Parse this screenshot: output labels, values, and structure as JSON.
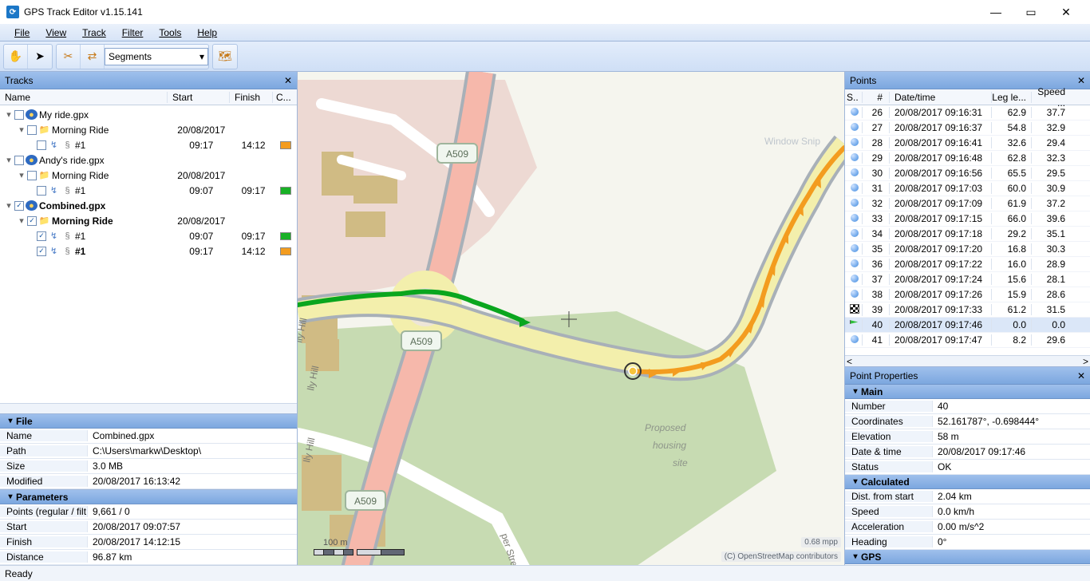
{
  "app": {
    "title": "GPS Track Editor v1.15.141"
  },
  "menu": {
    "items": [
      "File",
      "View",
      "Track",
      "Filter",
      "Tools",
      "Help"
    ]
  },
  "toolbar": {
    "segments_label": "Segments"
  },
  "panels": {
    "tracks_title": "Tracks",
    "points_title": "Points",
    "pointprops_title": "Point Properties"
  },
  "tracks_cols": {
    "name": "Name",
    "start": "Start",
    "finish": "Finish",
    "color": "C..."
  },
  "points_cols": {
    "s": "S..",
    "num": "#",
    "datetime": "Date/time",
    "leg": "Leg le...",
    "speed": "Speed ..."
  },
  "tracks": [
    {
      "kind": "gpx",
      "checked": false,
      "label": "My ride.gpx",
      "bold": false,
      "start": "",
      "finish": "",
      "color": ""
    },
    {
      "kind": "ride",
      "checked": false,
      "label": "Morning Ride",
      "bold": false,
      "start": "20/08/2017",
      "finish": "",
      "color": ""
    },
    {
      "kind": "seg",
      "checked": false,
      "label": "#1",
      "bold": false,
      "start": "09:17",
      "finish": "14:12",
      "color": "#f39c1f"
    },
    {
      "kind": "gpx",
      "checked": false,
      "label": "Andy's ride.gpx",
      "bold": false,
      "start": "",
      "finish": "",
      "color": ""
    },
    {
      "kind": "ride",
      "checked": false,
      "label": "Morning Ride",
      "bold": false,
      "start": "20/08/2017",
      "finish": "",
      "color": ""
    },
    {
      "kind": "seg",
      "checked": false,
      "label": "#1",
      "bold": false,
      "start": "09:07",
      "finish": "09:17",
      "color": "#19b126"
    },
    {
      "kind": "gpx",
      "checked": true,
      "label": "Combined.gpx",
      "bold": true,
      "start": "",
      "finish": "",
      "color": ""
    },
    {
      "kind": "ride",
      "checked": true,
      "label": "Morning Ride",
      "bold": true,
      "start": "20/08/2017",
      "finish": "",
      "color": ""
    },
    {
      "kind": "seg",
      "checked": true,
      "label": "#1",
      "bold": false,
      "start": "09:07",
      "finish": "09:17",
      "color": "#19b126"
    },
    {
      "kind": "seg",
      "checked": true,
      "label": "#1",
      "bold": true,
      "start": "09:17",
      "finish": "14:12",
      "color": "#f39c1f"
    }
  ],
  "file": {
    "header": "File",
    "rows": [
      {
        "label": "Name",
        "value": "Combined.gpx"
      },
      {
        "label": "Path",
        "value": "C:\\Users\\markw\\Desktop\\"
      },
      {
        "label": "Size",
        "value": "3.0 MB"
      },
      {
        "label": "Modified",
        "value": "20/08/2017 16:13:42"
      }
    ]
  },
  "parameters": {
    "header": "Parameters",
    "rows": [
      {
        "label": "Points (regular / filt",
        "value": "9,661 / 0"
      },
      {
        "label": "Start",
        "value": "20/08/2017 09:07:57"
      },
      {
        "label": "Finish",
        "value": "20/08/2017 14:12:15"
      },
      {
        "label": "Distance",
        "value": "96.87 km"
      }
    ]
  },
  "points": [
    {
      "icon": "dot",
      "num": "26",
      "dt": "20/08/2017 09:16:31",
      "leg": "62.9",
      "speed": "37.7",
      "sel": false
    },
    {
      "icon": "dot",
      "num": "27",
      "dt": "20/08/2017 09:16:37",
      "leg": "54.8",
      "speed": "32.9",
      "sel": false
    },
    {
      "icon": "dot",
      "num": "28",
      "dt": "20/08/2017 09:16:41",
      "leg": "32.6",
      "speed": "29.4",
      "sel": false
    },
    {
      "icon": "dot",
      "num": "29",
      "dt": "20/08/2017 09:16:48",
      "leg": "62.8",
      "speed": "32.3",
      "sel": false
    },
    {
      "icon": "dot",
      "num": "30",
      "dt": "20/08/2017 09:16:56",
      "leg": "65.5",
      "speed": "29.5",
      "sel": false
    },
    {
      "icon": "dot",
      "num": "31",
      "dt": "20/08/2017 09:17:03",
      "leg": "60.0",
      "speed": "30.9",
      "sel": false
    },
    {
      "icon": "dot",
      "num": "32",
      "dt": "20/08/2017 09:17:09",
      "leg": "61.9",
      "speed": "37.2",
      "sel": false
    },
    {
      "icon": "dot",
      "num": "33",
      "dt": "20/08/2017 09:17:15",
      "leg": "66.0",
      "speed": "39.6",
      "sel": false
    },
    {
      "icon": "dot",
      "num": "34",
      "dt": "20/08/2017 09:17:18",
      "leg": "29.2",
      "speed": "35.1",
      "sel": false
    },
    {
      "icon": "dot",
      "num": "35",
      "dt": "20/08/2017 09:17:20",
      "leg": "16.8",
      "speed": "30.3",
      "sel": false
    },
    {
      "icon": "dot",
      "num": "36",
      "dt": "20/08/2017 09:17:22",
      "leg": "16.0",
      "speed": "28.9",
      "sel": false
    },
    {
      "icon": "dot",
      "num": "37",
      "dt": "20/08/2017 09:17:24",
      "leg": "15.6",
      "speed": "28.1",
      "sel": false
    },
    {
      "icon": "dot",
      "num": "38",
      "dt": "20/08/2017 09:17:26",
      "leg": "15.9",
      "speed": "28.6",
      "sel": false
    },
    {
      "icon": "cheq",
      "num": "39",
      "dt": "20/08/2017 09:17:33",
      "leg": "61.2",
      "speed": "31.5",
      "sel": false
    },
    {
      "icon": "flag",
      "num": "40",
      "dt": "20/08/2017 09:17:46",
      "leg": "0.0",
      "speed": "0.0",
      "sel": true
    },
    {
      "icon": "dot",
      "num": "41",
      "dt": "20/08/2017 09:17:47",
      "leg": "8.2",
      "speed": "29.6",
      "sel": false
    }
  ],
  "point_props": {
    "main_header": "Main",
    "main": [
      {
        "label": "Number",
        "value": "40"
      },
      {
        "label": "Coordinates",
        "value": "52.161787°, -0.698444°"
      },
      {
        "label": "Elevation",
        "value": "58 m"
      },
      {
        "label": "Date & time",
        "value": "20/08/2017 09:17:46"
      },
      {
        "label": "Status",
        "value": "OK"
      }
    ],
    "calc_header": "Calculated",
    "calc": [
      {
        "label": "Dist. from start",
        "value": "2.04 km"
      },
      {
        "label": "Speed",
        "value": "0.0 km/h"
      },
      {
        "label": "Acceleration",
        "value": "0.00 m/s^2"
      },
      {
        "label": "Heading",
        "value": "0°"
      }
    ],
    "gps_header": "GPS"
  },
  "map": {
    "roads": {
      "a509": "A509"
    },
    "labels": {
      "lilly_hill": "lly Hill",
      "super_street": "per Street",
      "proposed_site": "Proposed housing site"
    },
    "scalebar": "100 m",
    "mpp": "0.68 mpp",
    "attribution": "(C) OpenStreetMap contributors",
    "window_snip": "Window Snip"
  },
  "status": {
    "ready": "Ready"
  }
}
